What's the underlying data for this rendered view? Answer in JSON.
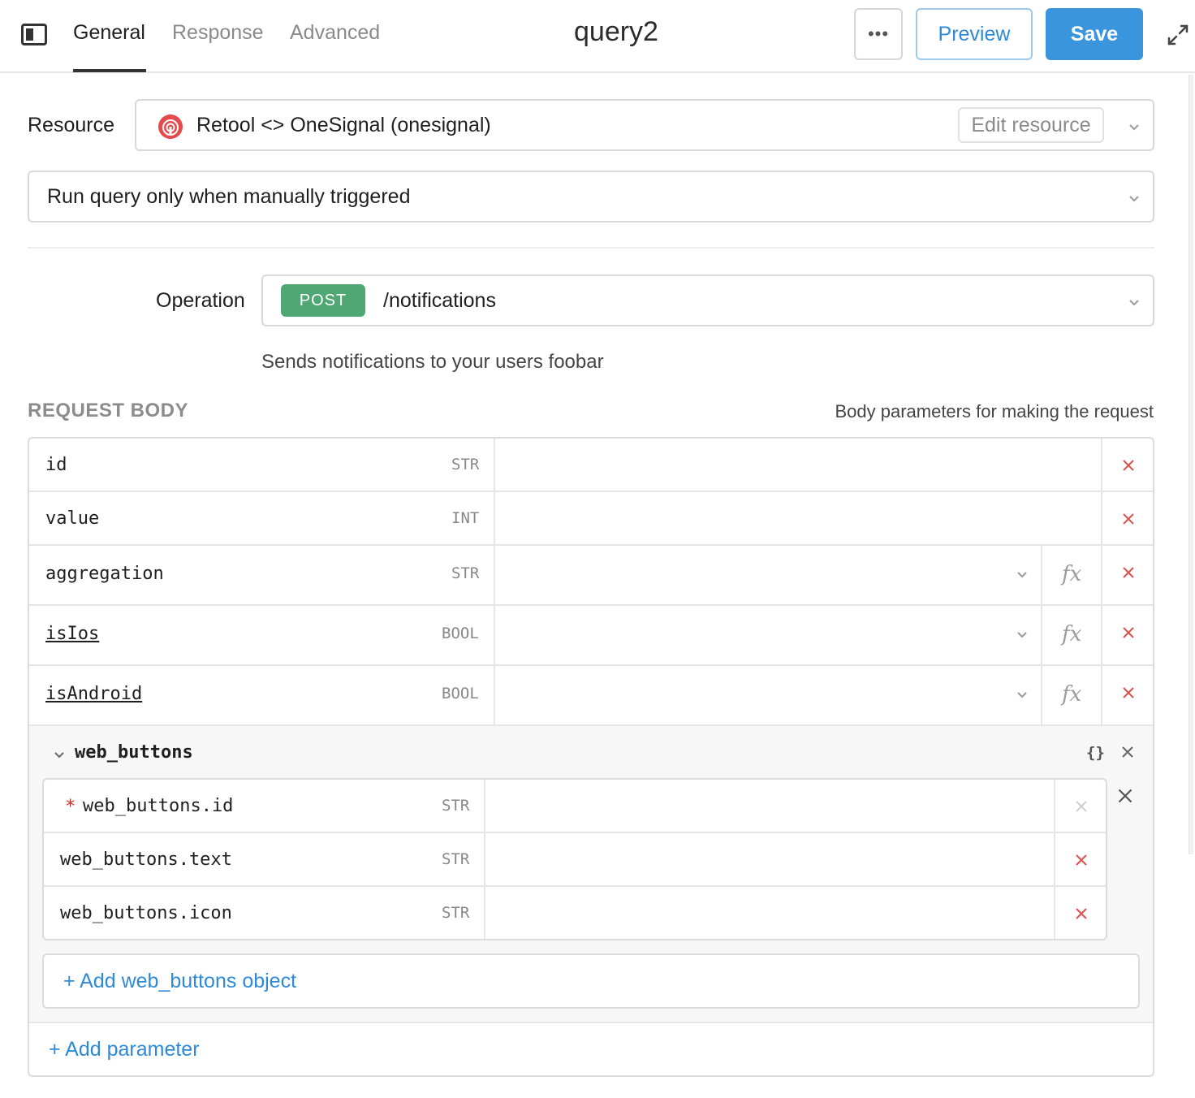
{
  "header": {
    "tabs": [
      {
        "label": "General",
        "active": true
      },
      {
        "label": "Response",
        "active": false
      },
      {
        "label": "Advanced",
        "active": false
      }
    ],
    "title": "query2",
    "more_label": "•••",
    "preview_label": "Preview",
    "save_label": "Save"
  },
  "resource": {
    "label": "Resource",
    "value": "Retool <> OneSignal (onesignal)",
    "edit_label": "Edit resource"
  },
  "trigger": {
    "value": "Run query only when manually triggered"
  },
  "operation": {
    "label": "Operation",
    "method": "POST",
    "path": "/notifications",
    "description": "Sends notifications to your users foobar"
  },
  "request_body": {
    "title": "REQUEST BODY",
    "hint": "Body parameters for making the request",
    "params": [
      {
        "name": "id",
        "type": "STR"
      },
      {
        "name": "value",
        "type": "INT"
      },
      {
        "name": "aggregation",
        "type": "STR"
      },
      {
        "name": "isIos",
        "type": "BOOL"
      },
      {
        "name": "isAndroid",
        "type": "BOOL"
      }
    ],
    "group": {
      "name": "web_buttons",
      "braces": "{}",
      "fields": [
        {
          "name": "web_buttons.id",
          "type": "STR",
          "required_mark": "*"
        },
        {
          "name": "web_buttons.text",
          "type": "STR"
        },
        {
          "name": "web_buttons.icon",
          "type": "STR"
        }
      ],
      "add_label": "+ Add web_buttons object"
    },
    "add_param_label": "+ Add parameter"
  },
  "colors": {
    "accent": "#3a95dd",
    "post": "#4fa874",
    "delete": "#d9534f"
  }
}
